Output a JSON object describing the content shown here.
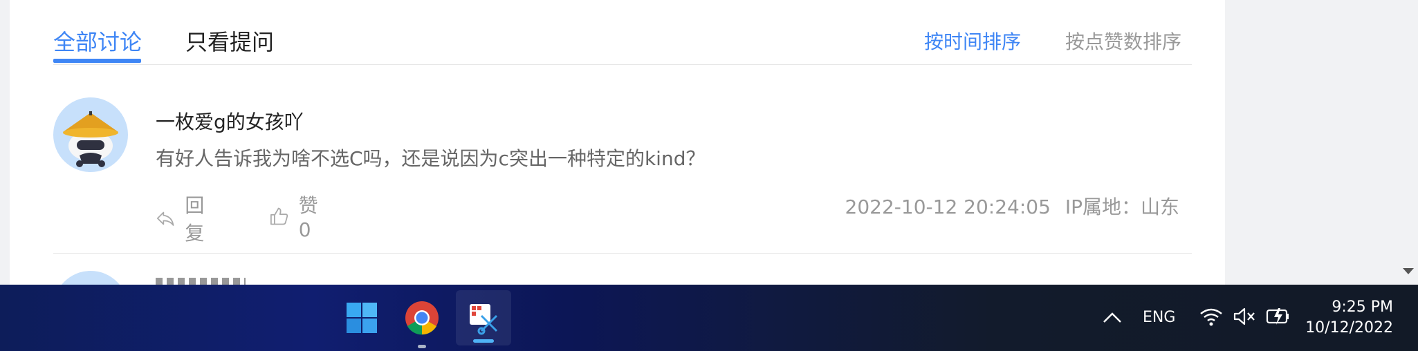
{
  "tabs": {
    "all": "全部讨论",
    "questions": "只看提问",
    "sort_time": "按时间排序",
    "sort_likes": "按点赞数排序"
  },
  "comment": {
    "username": "一枚爱g的女孩吖",
    "message": "有好人告诉我为啥不选C吗，还是说因为c突出一种特定的kind？",
    "reply_label": "回复",
    "like_label": "赞 0",
    "timestamp": "2022-10-12 20:24:05",
    "location": "IP属地：山东"
  },
  "taskbar": {
    "icons": [
      "windows-start-icon",
      "chrome-icon",
      "snipping-tool-icon"
    ],
    "tray": {
      "language": "ENG",
      "time": "9:25 PM",
      "date": "10/12/2022"
    }
  },
  "colors": {
    "accent": "#3f86f5",
    "muted": "#999999",
    "text": "#222222"
  }
}
